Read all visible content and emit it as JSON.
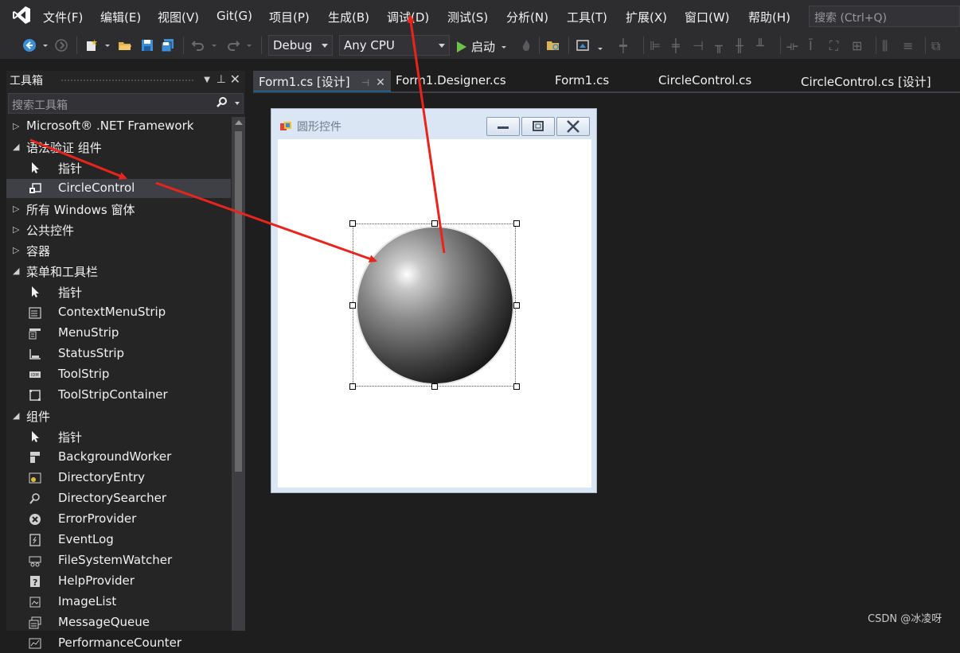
{
  "menubar": {
    "items": [
      "文件(F)",
      "编辑(E)",
      "视图(V)",
      "Git(G)",
      "项目(P)",
      "生成(B)",
      "调试(D)",
      "测试(S)",
      "分析(N)",
      "工具(T)",
      "扩展(X)",
      "窗口(W)",
      "帮助(H)"
    ],
    "search_placeholder": "搜索 (Ctrl+Q)"
  },
  "toolbar": {
    "config": "Debug",
    "platform": "Any CPU",
    "start_label": "启动"
  },
  "toolbox": {
    "title": "工具箱",
    "search_placeholder": "搜索工具箱",
    "items": [
      {
        "kind": "cat",
        "expanded": false,
        "label": "Microsoft® .NET Framework"
      },
      {
        "kind": "cat",
        "expanded": true,
        "label": "语法验证 组件"
      },
      {
        "kind": "item",
        "icon": "pointer-icon",
        "label": "指针"
      },
      {
        "kind": "item",
        "icon": "user-control-icon",
        "label": "CircleControl",
        "selected": true
      },
      {
        "kind": "cat",
        "expanded": false,
        "label": "所有 Windows 窗体"
      },
      {
        "kind": "cat",
        "expanded": false,
        "label": "公共控件"
      },
      {
        "kind": "cat",
        "expanded": false,
        "label": "容器"
      },
      {
        "kind": "cat",
        "expanded": true,
        "label": "菜单和工具栏"
      },
      {
        "kind": "item",
        "icon": "pointer-icon",
        "label": "指针"
      },
      {
        "kind": "item",
        "icon": "context-menu-icon",
        "label": "ContextMenuStrip"
      },
      {
        "kind": "item",
        "icon": "menu-strip-icon",
        "label": "MenuStrip"
      },
      {
        "kind": "item",
        "icon": "status-strip-icon",
        "label": "StatusStrip"
      },
      {
        "kind": "item",
        "icon": "toolstrip-icon",
        "label": "ToolStrip"
      },
      {
        "kind": "item",
        "icon": "toolstrip-container-icon",
        "label": "ToolStripContainer"
      },
      {
        "kind": "cat",
        "expanded": true,
        "label": "组件"
      },
      {
        "kind": "item",
        "icon": "pointer-icon",
        "label": "指针"
      },
      {
        "kind": "item",
        "icon": "background-worker-icon",
        "label": "BackgroundWorker"
      },
      {
        "kind": "item",
        "icon": "directory-entry-icon",
        "label": "DirectoryEntry"
      },
      {
        "kind": "item",
        "icon": "directory-searcher-icon",
        "label": "DirectorySearcher"
      },
      {
        "kind": "item",
        "icon": "error-provider-icon",
        "label": "ErrorProvider"
      },
      {
        "kind": "item",
        "icon": "event-log-icon",
        "label": "EventLog"
      },
      {
        "kind": "item",
        "icon": "file-watcher-icon",
        "label": "FileSystemWatcher"
      },
      {
        "kind": "item",
        "icon": "help-provider-icon",
        "label": "HelpProvider"
      },
      {
        "kind": "item",
        "icon": "image-list-icon",
        "label": "ImageList"
      },
      {
        "kind": "item",
        "icon": "message-queue-icon",
        "label": "MessageQueue"
      },
      {
        "kind": "item",
        "icon": "performance-counter-icon",
        "label": "PerformanceCounter"
      }
    ]
  },
  "tabs": [
    {
      "label": "Form1.cs [设计]",
      "active": true
    },
    {
      "label": "Form1.Designer.cs",
      "active": false
    },
    {
      "label": "Form1.cs",
      "active": false
    },
    {
      "label": "CircleControl.cs",
      "active": false
    },
    {
      "label": "CircleControl.cs [设计]",
      "active": false
    }
  ],
  "form": {
    "title": "圆形控件"
  },
  "watermark": "CSDN @冰凌呀",
  "colors": {
    "accent": "#007acc",
    "annotation_arrow": "#e8241c",
    "play_green": "#6cc24a"
  }
}
